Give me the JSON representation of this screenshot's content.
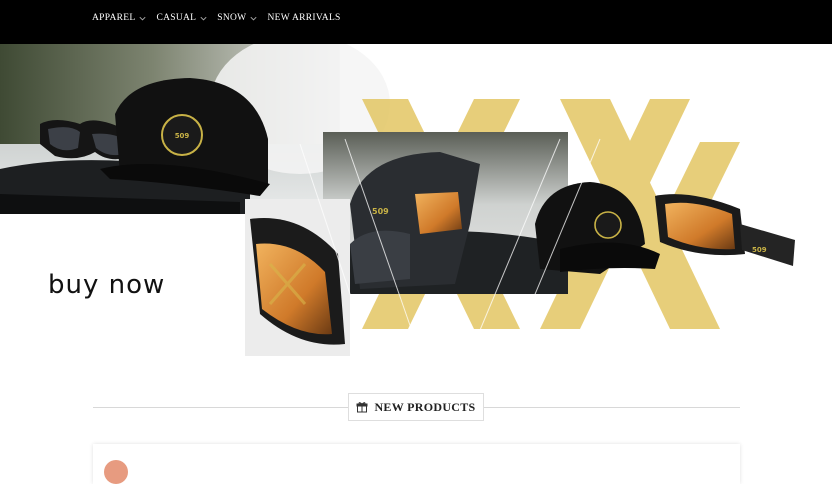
{
  "nav": {
    "items": [
      {
        "label": "APPAREL",
        "has_dropdown": true
      },
      {
        "label": "CASUAL",
        "has_dropdown": true
      },
      {
        "label": "SNOW",
        "has_dropdown": true
      },
      {
        "label": "NEW ARRIVALS",
        "has_dropdown": false
      }
    ]
  },
  "hero": {
    "cta_label": "buy now",
    "accent_color": "#e2c35a"
  },
  "section": {
    "title": "NEW PRODUCTS",
    "icon": "gift-icon"
  }
}
